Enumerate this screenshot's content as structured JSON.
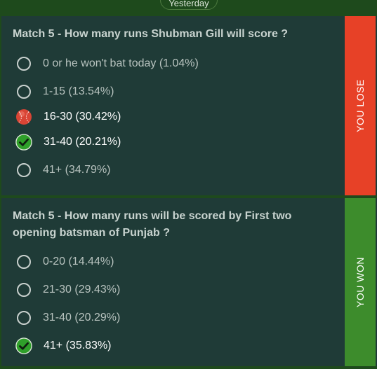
{
  "header": {
    "day_label": "Yesterday"
  },
  "questions": [
    {
      "title": "Match 5 - How many runs Shubman Gill will score ?",
      "result": "YOU LOSE",
      "options": [
        {
          "label": "0 or he won't bat today (1.04%)",
          "state": "none"
        },
        {
          "label": "1-15 (13.54%)",
          "state": "none"
        },
        {
          "label": "16-30 (30.42%)",
          "state": "your-pick"
        },
        {
          "label": "31-40 (20.21%)",
          "state": "correct"
        },
        {
          "label": "41+ (34.79%)",
          "state": "none"
        }
      ]
    },
    {
      "title": "Match 5 - How many runs will be scored by First two opening batsman of Punjab ?",
      "result": "YOU WON",
      "options": [
        {
          "label": "0-20 (14.44%)",
          "state": "none"
        },
        {
          "label": "21-30 (29.43%)",
          "state": "none"
        },
        {
          "label": "31-40 (20.29%)",
          "state": "none"
        },
        {
          "label": "41+ (35.83%)",
          "state": "correct"
        }
      ]
    }
  ],
  "colors": {
    "background": "#1e4a1c",
    "card": "#1f3b37",
    "lose": "#e74127",
    "won": "#3d8c2c",
    "check": "#2fa02a",
    "ball": "#d94535"
  },
  "icons": {
    "unselected": "radio-empty-icon",
    "your_pick": "cricket-ball-icon",
    "correct": "green-check-icon"
  }
}
